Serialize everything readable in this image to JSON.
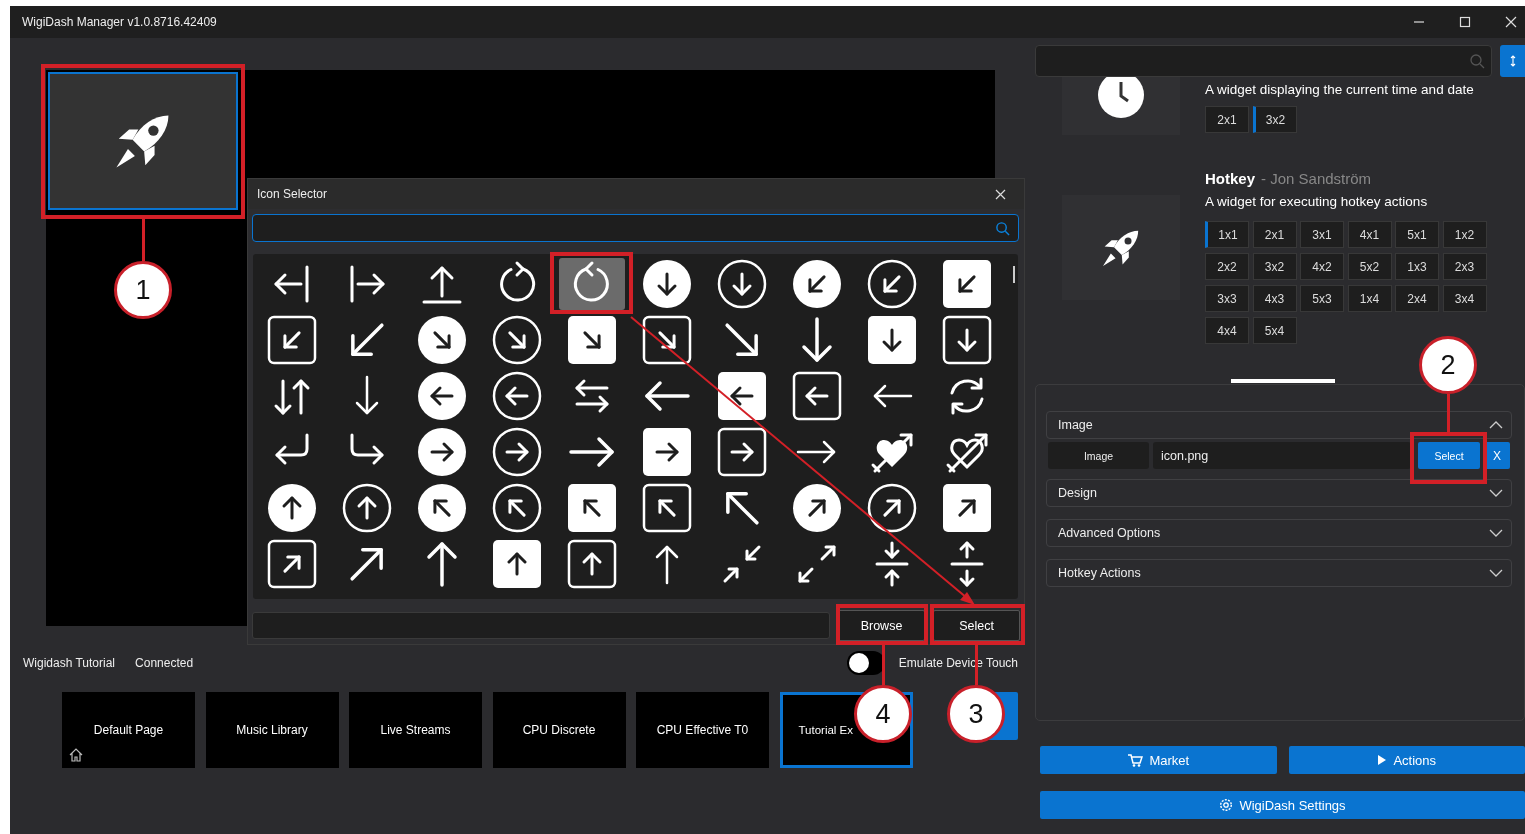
{
  "window": {
    "title": "WigiDash Manager v1.0.8716.42409"
  },
  "widget_tile": {
    "selected": true
  },
  "icon_selector": {
    "title": "Icon Selector",
    "icons": [
      {
        "selected": false
      },
      {
        "selected": false
      },
      {
        "selected": false
      },
      {
        "selected": false
      },
      {
        "selected": true
      },
      {
        "selected": false
      },
      {
        "selected": false
      },
      {
        "selected": false
      },
      {
        "selected": false
      },
      {
        "selected": false
      },
      {
        "selected": false
      },
      {
        "selected": false
      },
      {
        "selected": false
      },
      {
        "selected": false
      },
      {
        "selected": false
      },
      {
        "selected": false
      },
      {
        "selected": false
      },
      {
        "selected": false
      },
      {
        "selected": false
      },
      {
        "selected": false
      },
      {
        "selected": false
      },
      {
        "selected": false
      },
      {
        "selected": false
      },
      {
        "selected": false
      },
      {
        "selected": false
      },
      {
        "selected": false
      },
      {
        "selected": false
      },
      {
        "selected": false
      },
      {
        "selected": false
      },
      {
        "selected": false
      },
      {
        "selected": false
      },
      {
        "selected": false
      },
      {
        "selected": false
      },
      {
        "selected": false
      },
      {
        "selected": false
      },
      {
        "selected": false
      },
      {
        "selected": false
      },
      {
        "selected": false
      },
      {
        "selected": false
      },
      {
        "selected": false
      },
      {
        "selected": false
      },
      {
        "selected": false
      },
      {
        "selected": false
      },
      {
        "selected": false
      },
      {
        "selected": false
      },
      {
        "selected": false
      },
      {
        "selected": false
      },
      {
        "selected": false
      },
      {
        "selected": false
      },
      {
        "selected": false
      },
      {
        "selected": false
      },
      {
        "selected": false
      },
      {
        "selected": false
      },
      {
        "selected": false
      },
      {
        "selected": false
      },
      {
        "selected": false
      },
      {
        "selected": false
      },
      {
        "selected": false
      },
      {
        "selected": false
      },
      {
        "selected": false
      }
    ],
    "buttons": [
      "Browse",
      "Select"
    ]
  },
  "status": {
    "device": "Wigidash Tutorial",
    "connection": "Connected"
  },
  "emulate_touch": {
    "label": "Emulate Device Touch",
    "on": false
  },
  "pages": [
    {
      "label": "Default Page",
      "home": true,
      "selected": false
    },
    {
      "label": "Music Library",
      "home": false,
      "selected": false
    },
    {
      "label": "Live Streams",
      "home": false,
      "selected": false
    },
    {
      "label": "CPU Discrete",
      "home": false,
      "selected": false
    },
    {
      "label": "CPU Effective T0",
      "home": false,
      "selected": false
    },
    {
      "label": "Tutorial Ex",
      "home": false,
      "selected": true
    }
  ],
  "widgets": [
    {
      "kind": "clock",
      "description": "A widget displaying the current time and date",
      "sizes": [
        {
          "label": "2x1",
          "selected": false
        },
        {
          "label": "3x2",
          "selected": true
        }
      ]
    },
    {
      "kind": "hotkey",
      "name": "Hotkey",
      "author": "- Jon Sandström",
      "description": "A widget for executing hotkey actions",
      "sizes": [
        {
          "label": "1x1",
          "selected": true
        },
        {
          "label": "2x1",
          "selected": false
        },
        {
          "label": "3x1",
          "selected": false
        },
        {
          "label": "4x1",
          "selected": false
        },
        {
          "label": "5x1",
          "selected": false
        },
        {
          "label": "1x2",
          "selected": false
        },
        {
          "label": "2x2",
          "selected": false
        },
        {
          "label": "3x2",
          "selected": false
        },
        {
          "label": "4x2",
          "selected": false
        },
        {
          "label": "5x2",
          "selected": false
        },
        {
          "label": "1x3",
          "selected": false
        },
        {
          "label": "2x3",
          "selected": false
        },
        {
          "label": "3x3",
          "selected": false
        },
        {
          "label": "4x3",
          "selected": false
        },
        {
          "label": "5x3",
          "selected": false
        },
        {
          "label": "1x4",
          "selected": false
        },
        {
          "label": "2x4",
          "selected": false
        },
        {
          "label": "3x4",
          "selected": false
        },
        {
          "label": "4x4",
          "selected": false
        },
        {
          "label": "5x4",
          "selected": false
        }
      ]
    }
  ],
  "properties": {
    "sections": [
      {
        "title": "Image",
        "expanded": true
      },
      {
        "title": "Design",
        "expanded": false
      },
      {
        "title": "Advanced Options",
        "expanded": false
      },
      {
        "title": "Hotkey Actions",
        "expanded": false
      }
    ],
    "image_row": {
      "label": "Image",
      "value": "icon.png",
      "select": "Select",
      "clear": "X"
    }
  },
  "bottom_buttons": [
    {
      "label": "Market",
      "kind": "market"
    },
    {
      "label": "Actions",
      "kind": "actions"
    },
    {
      "label": "WigiDash Settings",
      "kind": "settings"
    }
  ],
  "callouts": [
    {
      "number": "1"
    },
    {
      "number": "2"
    },
    {
      "number": "3"
    },
    {
      "number": "4"
    }
  ]
}
